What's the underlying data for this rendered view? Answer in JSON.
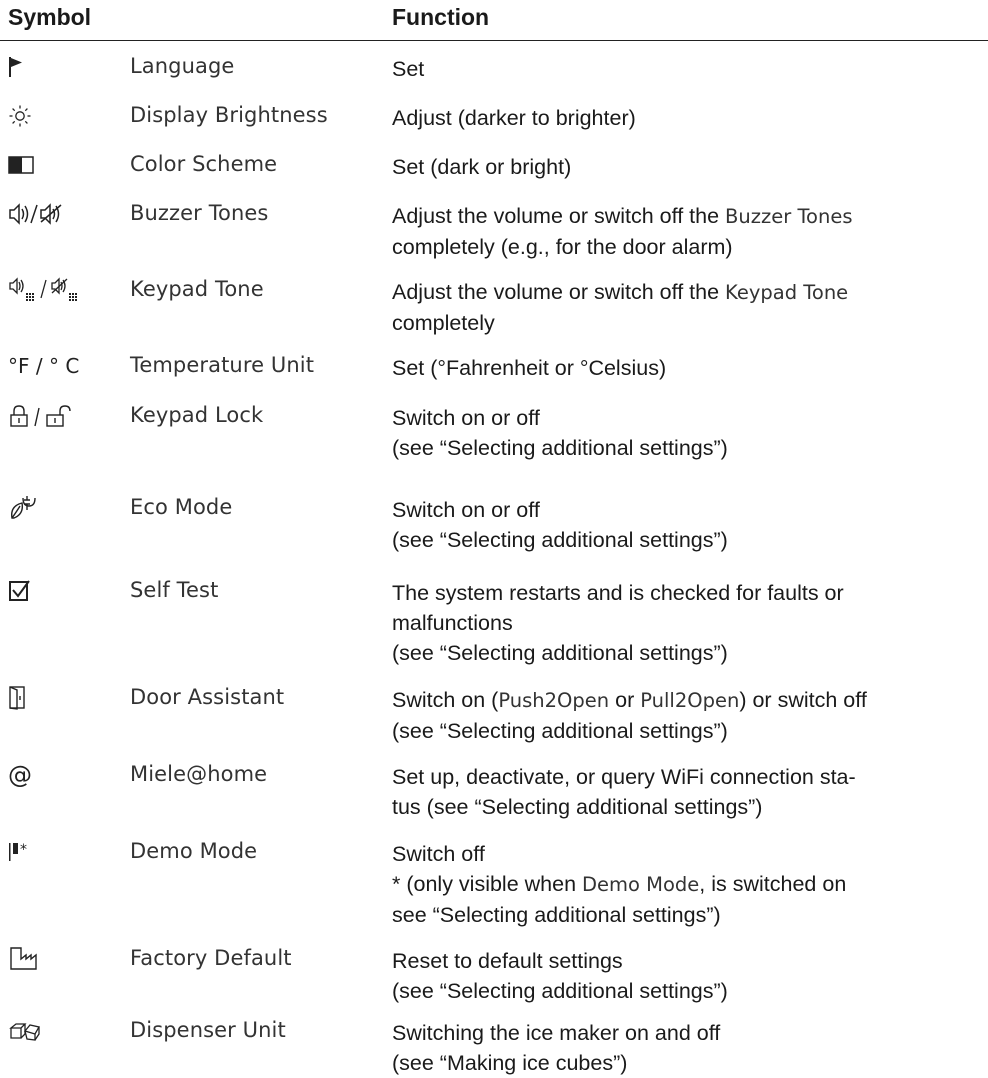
{
  "header": {
    "symbol": "Symbol",
    "function": "Function"
  },
  "rows": [
    {
      "icon": "flag-icon",
      "label": "Language",
      "lines": [
        [
          "Set"
        ]
      ]
    },
    {
      "icon": "brightness-icon",
      "label": "Display Brightness",
      "lines": [
        [
          "Adjust (darker to brighter)"
        ]
      ]
    },
    {
      "icon": "color-scheme-icon",
      "label": "Color Scheme",
      "lines": [
        [
          "Set (dark or bright)"
        ]
      ]
    },
    {
      "icon": "speaker-icon",
      "label": "Buzzer Tones",
      "lines": [
        [
          "Adjust the volume or switch off the ",
          "Buzzer Tones"
        ],
        [
          "completely (e.g., for the door alarm)"
        ]
      ]
    },
    {
      "icon": "keypad-speaker-icon",
      "label": "Keypad Tone",
      "lines": [
        [
          "Adjust the volume or switch off the ",
          "Keypad Tone"
        ],
        [
          "completely"
        ]
      ]
    },
    {
      "icon": "temperature-unit-icon",
      "icon_text": "°F / ° C",
      "label": "Temperature Unit",
      "lines": [
        [
          "Set (°Fahrenheit or °Celsius)"
        ]
      ]
    },
    {
      "icon": "lock-icon",
      "label": "Keypad Lock",
      "lines": [
        [
          "Switch on or off"
        ],
        [
          "(see “Selecting additional settings”)"
        ]
      ]
    },
    {
      "icon": "eco-icon",
      "label": "Eco Mode",
      "lines": [
        [
          "Switch on or off"
        ],
        [
          "(see “Selecting additional settings”)"
        ]
      ]
    },
    {
      "icon": "checkbox-icon",
      "label": "Self Test",
      "lines": [
        [
          "The system restarts and is checked for faults or"
        ],
        [
          "malfunctions"
        ],
        [
          "(see “Selecting additional settings”)"
        ]
      ]
    },
    {
      "icon": "door-icon",
      "label": "Door Assistant",
      "lines": [
        [
          "Switch on (",
          "Push2Open",
          " or ",
          "Pull2Open",
          ") or switch off"
        ],
        [
          "(see “Selecting additional settings”)"
        ]
      ]
    },
    {
      "icon": "at-icon",
      "icon_text": "@",
      "label": "Miele@home",
      "lines": [
        [
          "Set up, deactivate, or query WiFi connection sta-"
        ],
        [
          "tus (see “Selecting additional settings”)"
        ]
      ]
    },
    {
      "icon": "demo-icon",
      "label": "Demo Mode",
      "lines": [
        [
          "Switch off"
        ],
        [
          "* (only visible when ",
          "Demo Mode",
          ", is switched on"
        ],
        [
          "see “Selecting additional settings”)"
        ]
      ]
    },
    {
      "icon": "factory-icon",
      "label": "Factory Default",
      "lines": [
        [
          "Reset to default settings"
        ],
        [
          "(see “Selecting additional settings”)"
        ]
      ]
    },
    {
      "icon": "ice-cube-icon",
      "label": "Dispenser Unit",
      "lines": [
        [
          "Switching the ice maker on and off"
        ],
        [
          "(see “Making ice cubes”)"
        ]
      ]
    }
  ]
}
